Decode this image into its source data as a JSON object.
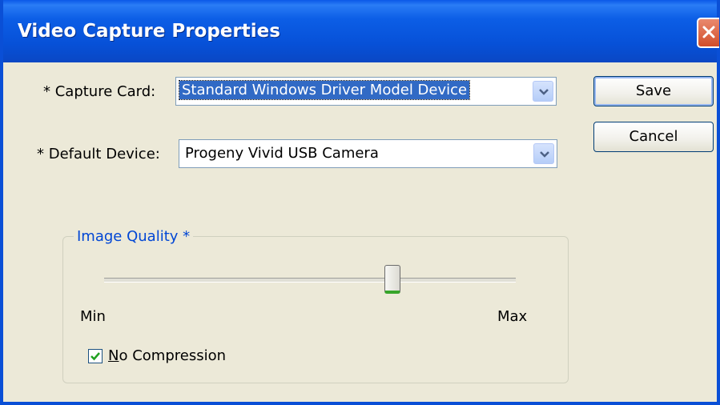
{
  "window": {
    "title": "Video Capture Properties"
  },
  "capture_card": {
    "label": "* Capture Card:",
    "value": "Standard Windows Driver Model Device"
  },
  "default_device": {
    "label": "* Default Device:",
    "value": "Progeny Vivid USB Camera"
  },
  "buttons": {
    "save": "Save",
    "cancel": "Cancel"
  },
  "image_quality": {
    "group_title": "Image Quality *",
    "min_label": "Min",
    "max_label": "Max",
    "level": 0.7
  },
  "no_compression": {
    "label_mnemonic": "N",
    "label_rest": "o Compression",
    "checked": true
  },
  "colors": {
    "titlebar": "#0751d8",
    "window_bg": "#ece9d8",
    "selection": "#316ac5",
    "accent_text": "#0046d5",
    "slider_thumb_accent": "#37a52a"
  },
  "icons": {
    "close": "close-icon",
    "dropdown": "chevron-down-icon",
    "check": "checkmark-icon"
  }
}
